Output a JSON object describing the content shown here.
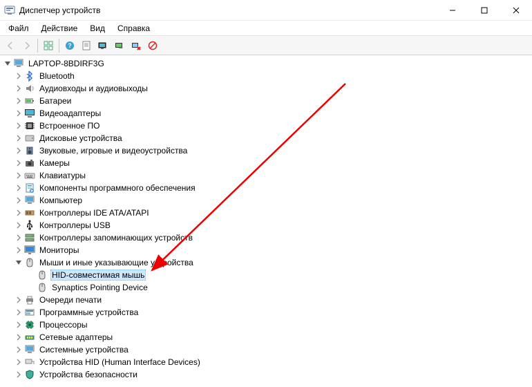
{
  "window": {
    "title": "Диспетчер устройств"
  },
  "menu": {
    "file": "Файл",
    "action": "Действие",
    "view": "Вид",
    "help": "Справка"
  },
  "tree": {
    "root": "LAPTOP-8BDIRF3G",
    "n0": "Bluetooth",
    "n1": "Аудиовходы и аудиовыходы",
    "n2": "Батареи",
    "n3": "Видеоадаптеры",
    "n4": "Встроенное ПО",
    "n5": "Дисковые устройства",
    "n6": "Звуковые, игровые и видеоустройства",
    "n7": "Камеры",
    "n8": "Клавиатуры",
    "n9": "Компоненты программного обеспечения",
    "n10": "Компьютер",
    "n11": "Контроллеры IDE ATA/ATAPI",
    "n12": "Контроллеры USB",
    "n13": "Контроллеры запоминающих устройств",
    "n14": "Мониторы",
    "n15": "Мыши и иные указывающие устройства",
    "n15a": "HID-совместимая мышь",
    "n15b": "Synaptics Pointing Device",
    "n16": "Очереди печати",
    "n17": "Программные устройства",
    "n18": "Процессоры",
    "n19": "Сетевые адаптеры",
    "n20": "Системные устройства",
    "n21": "Устройства HID (Human Interface Devices)",
    "n22": "Устройства безопасности"
  }
}
